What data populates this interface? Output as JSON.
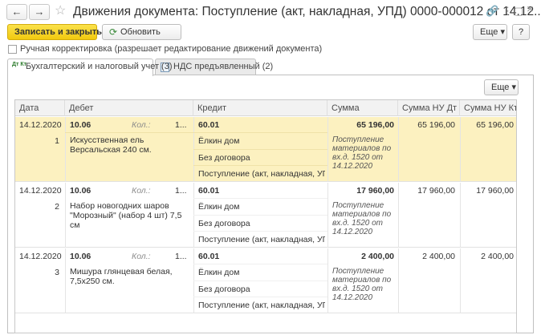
{
  "window": {
    "title": "Движения документа: Поступление (акт, накладная, УПД) 0000-000012 от 14.12....",
    "back_glyph": "←",
    "forward_glyph": "→",
    "star_glyph": "☆",
    "link_glyph": "🔗",
    "menu_glyph": "⋮",
    "restore_glyph": "▢",
    "close_glyph": "×"
  },
  "toolbar": {
    "save_close_label": "Записать и закрыть",
    "refresh_label": "Обновить",
    "refresh_glyph": "⟳",
    "more_label": "Еще ▾",
    "help_label": "?"
  },
  "manual_correction": {
    "label": "Ручная корректировка (разрешает редактирование движений документа)",
    "checked": false
  },
  "tabs": [
    {
      "label": "Бухгалтерский и налоговый учет (3)",
      "icon_text": "Дт Кт",
      "active": true
    },
    {
      "label": "НДС предъявленный (2)",
      "active": false
    }
  ],
  "panel": {
    "more_label": "Еще ▾"
  },
  "table": {
    "columns": [
      "Дата",
      "Дебет",
      "Кредит",
      "Сумма",
      "Сумма НУ Дт",
      "Сумма НУ Кт"
    ],
    "rows": [
      {
        "date": "14.12.2020",
        "num": "1",
        "debit_account": "10.06",
        "qty_label": "Кол.:",
        "qty_value": "1...",
        "debit_subconto": "Искусственная ель Версальская 240 см.",
        "credit_account": "60.01",
        "credit_sub1": "Ёлкин дом",
        "credit_sub2": "Без договора",
        "credit_sub3": "Поступление (акт, накладная, УПД...",
        "sum": "65 196,00",
        "sum_nu_dt": "65 196,00",
        "sum_nu_kt": "65 196,00",
        "content": "Поступление материалов по вх.д. 1520 от 14.12.2020",
        "selected": true
      },
      {
        "date": "14.12.2020",
        "num": "2",
        "debit_account": "10.06",
        "qty_label": "Кол.:",
        "qty_value": "1...",
        "debit_subconto": "Набор новогодних шаров \"Морозный\" (набор 4 шт) 7,5 см",
        "credit_account": "60.01",
        "credit_sub1": "Ёлкин дом",
        "credit_sub2": "Без договора",
        "credit_sub3": "Поступление (акт, накладная, УПД...",
        "sum": "17 960,00",
        "sum_nu_dt": "17 960,00",
        "sum_nu_kt": "17 960,00",
        "content": "Поступление материалов по вх.д. 1520 от 14.12.2020",
        "selected": false
      },
      {
        "date": "14.12.2020",
        "num": "3",
        "debit_account": "10.06",
        "qty_label": "Кол.:",
        "qty_value": "1...",
        "debit_subconto": "Мишура глянцевая белая, 7,5x250 см.",
        "credit_account": "60.01",
        "credit_sub1": "Ёлкин дом",
        "credit_sub2": "Без договора",
        "credit_sub3": "Поступление (акт, накладная, УПД...",
        "sum": "2 400,00",
        "sum_nu_dt": "2 400,00",
        "sum_nu_kt": "2 400,00",
        "content": "Поступление материалов по вх.д. 1520 от 14.12.2020",
        "selected": false
      }
    ]
  },
  "colors": {
    "primary_button": "#f4cc1b",
    "selected_row": "#fcf1c0"
  }
}
